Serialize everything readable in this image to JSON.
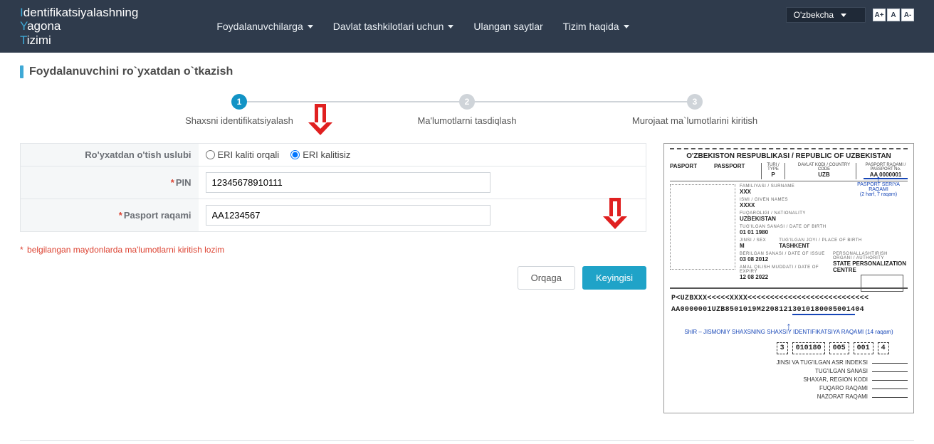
{
  "brand": {
    "line1_pre": "I",
    "line1": "dentifikatsiyalashning",
    "line2_pre": "Y",
    "line2": "agona",
    "line3_pre": "T",
    "line3": "izimi"
  },
  "nav": {
    "items": [
      {
        "label": "Foydalanuvchilarga",
        "caret": true
      },
      {
        "label": "Davlat tashkilotlari uchun",
        "caret": true
      },
      {
        "label": "Ulangan saytlar",
        "caret": false
      },
      {
        "label": "Tizim haqida",
        "caret": true
      }
    ]
  },
  "lang": {
    "selected": "O'zbekcha"
  },
  "font_buttons": {
    "inc": "A+",
    "normal": "A",
    "dec": "A-"
  },
  "page": {
    "title": "Foydalanuvchini ro`yxatdan o`tkazish"
  },
  "wizard": {
    "steps": [
      {
        "num": "1",
        "label": "Shaxsni identifikatsiyalash",
        "active": true
      },
      {
        "num": "2",
        "label": "Ma'lumotlarni tasdiqlash",
        "active": false
      },
      {
        "num": "3",
        "label": "Murojaat ma`lumotlarini kiritish",
        "active": false
      }
    ]
  },
  "form": {
    "method_label": "Ro'yxatdan o'tish uslubi",
    "radio1": "ERI kaliti orqali",
    "radio2": "ERI kalitisiz",
    "pin_label": "PIN",
    "pin_value": "12345678910111",
    "passport_label": "Pasport raqami",
    "passport_value": "AA1234567",
    "hint": "belgilangan maydonlarda ma'lumotlarni kiritish lozim",
    "back_btn": "Orqaga",
    "next_btn": "Keyingisi"
  },
  "passport": {
    "header": "O'ZBEKISTON RESPUBLIKASI / REPUBLIC OF UZBEKISTAN",
    "pasport1": "PASPORT",
    "pasport2": "PASSPORT",
    "type_lbl": "TURI / TYPE",
    "type_val": "P",
    "code_lbl": "DAVLAT KODI / COUNTRY CODE",
    "code_val": "UZB",
    "serial_lbl": "PASPORT RAQAMI / PASSPORT No.",
    "serial_val": "AA 0000001",
    "annot_serial": "PASPORT SERIYA RAQAMI",
    "annot_serial2": "(2 harf, 7 raqam)",
    "surname_lbl": "FAMILIYASI / SURNAME",
    "surname": "XXX",
    "given_lbl": "ISMI / GIVEN NAMES",
    "given": "XXXX",
    "nat_lbl": "FUQAROLIGI / NATIONALITY",
    "nat": "UZBEKISTAN",
    "dob_lbl": "TUG'ILGAN SANASI / DATE OF BIRTH",
    "dob": "01   01   1980",
    "sex_lbl": "JINSI / SEX",
    "sex": "M",
    "pob_lbl": "TUG'ILGAN JOYI / PLACE OF BIRTH",
    "pob": "TASHKENT",
    "issue_lbl": "BERILGAN SANASI / DATE OF ISSUE",
    "issue": "03   08   2012",
    "expiry_lbl": "AMAL QILISH MUDDATI / DATE OF EXPIRY",
    "expiry": "12   08   2022",
    "auth_lbl": "PERSONALLASHTIRISH ORGANI / AUTHORITY",
    "auth": "STATE PERSONALIZATION CENTRE",
    "mrz1": "P<UZBXXX<<<<<XXXX<<<<<<<<<<<<<<<<<<<<<<<<<<<",
    "mrz2a": "AA0000001UZB8501019M2208121",
    "mrz2_pin": "30101800050014",
    "mrz2b": "04",
    "shir": "ShIR – JISMONIY SHAXSNING SHAXSIY IDENTIFIKATSIYA RAQAMI (14 raqam)",
    "boxes": [
      "3",
      "010180",
      "005",
      "001",
      "4"
    ],
    "legend": [
      "JINSI VA TUG'ILGAN ASR INDEKSI",
      "TUG'ILGAN SANASI",
      "SHAXAR, REGION KODI",
      "FUQARO RAQAMI",
      "NAZORAT RAQAMI"
    ]
  }
}
